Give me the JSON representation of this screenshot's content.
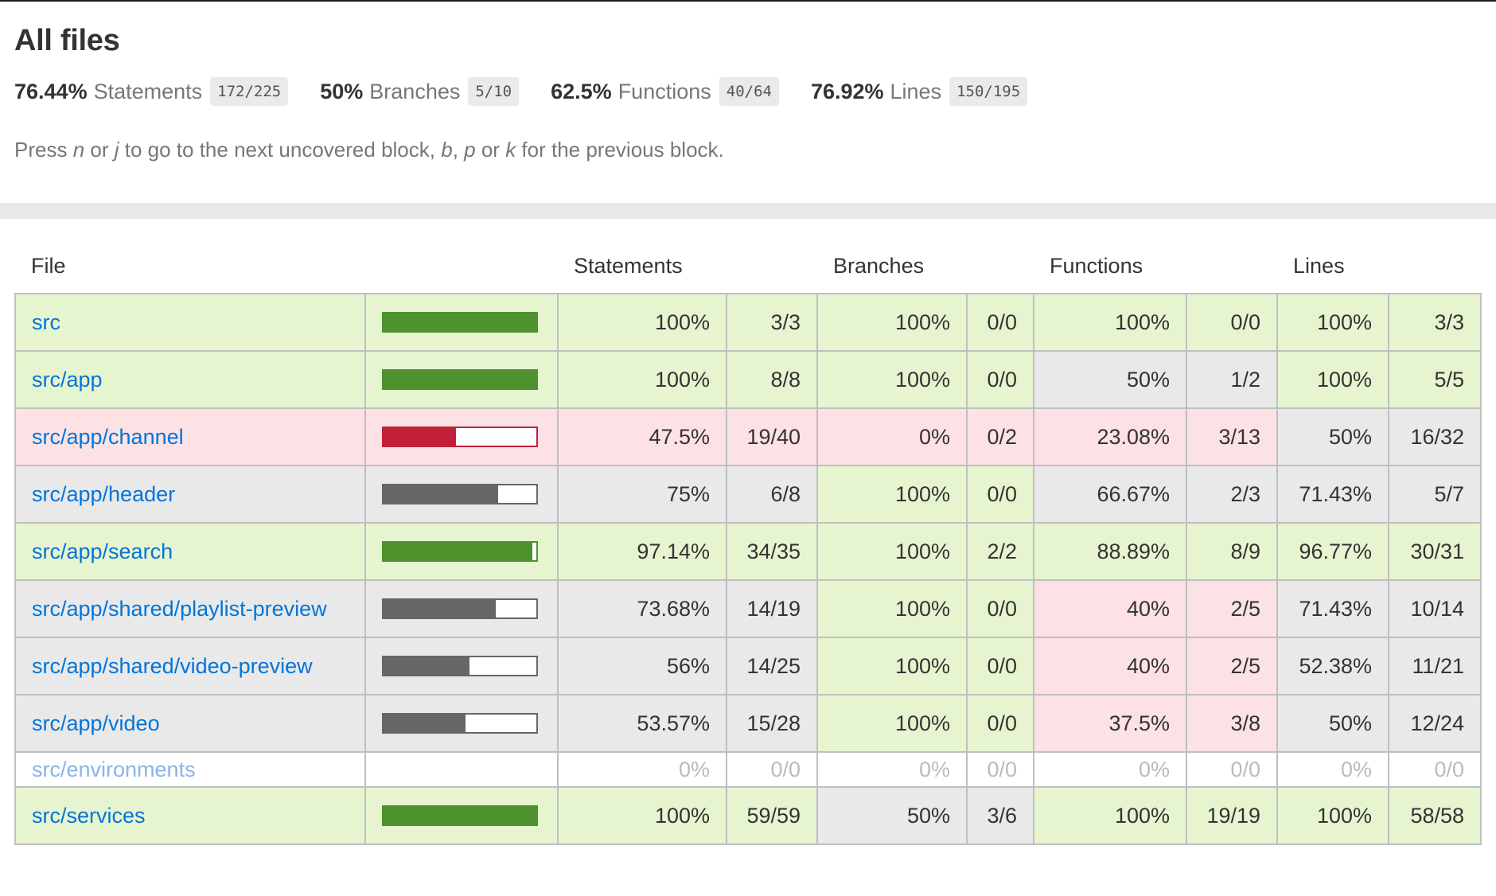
{
  "title": "All files",
  "summary": [
    {
      "pct": "76.44%",
      "label": "Statements",
      "frac": "172/225"
    },
    {
      "pct": "50%",
      "label": "Branches",
      "frac": "5/10"
    },
    {
      "pct": "62.5%",
      "label": "Functions",
      "frac": "40/64"
    },
    {
      "pct": "76.92%",
      "label": "Lines",
      "frac": "150/195"
    }
  ],
  "hint": {
    "t1": "Press ",
    "k1": "n",
    "t2": " or ",
    "k2": "j",
    "t3": " to go to the next uncovered block, ",
    "k3": "b",
    "t4": ", ",
    "k4": "p",
    "t5": " or ",
    "k5": "k",
    "t6": " for the previous block."
  },
  "table": {
    "headers": {
      "file": "File",
      "statements": "Statements",
      "branches": "Branches",
      "functions": "Functions",
      "lines": "Lines"
    },
    "rows": [
      {
        "file": "src",
        "bar_pct": 100,
        "stmt_pct": "100%",
        "stmt_frac": "3/3",
        "br_pct": "100%",
        "br_frac": "0/0",
        "fn_pct": "100%",
        "fn_frac": "0/0",
        "ln_pct": "100%",
        "ln_frac": "3/3",
        "c_stmt": "high",
        "c_br": "high",
        "c_fn": "high",
        "c_ln": "high",
        "c_file": "high"
      },
      {
        "file": "src/app",
        "bar_pct": 100,
        "stmt_pct": "100%",
        "stmt_frac": "8/8",
        "br_pct": "100%",
        "br_frac": "0/0",
        "fn_pct": "50%",
        "fn_frac": "1/2",
        "ln_pct": "100%",
        "ln_frac": "5/5",
        "c_stmt": "high",
        "c_br": "high",
        "c_fn": "medium",
        "c_ln": "high",
        "c_file": "high"
      },
      {
        "file": "src/app/channel",
        "bar_pct": 47.5,
        "stmt_pct": "47.5%",
        "stmt_frac": "19/40",
        "br_pct": "0%",
        "br_frac": "0/2",
        "fn_pct": "23.08%",
        "fn_frac": "3/13",
        "ln_pct": "50%",
        "ln_frac": "16/32",
        "c_stmt": "low",
        "c_br": "low",
        "c_fn": "low",
        "c_ln": "medium",
        "c_file": "low"
      },
      {
        "file": "src/app/header",
        "bar_pct": 75,
        "stmt_pct": "75%",
        "stmt_frac": "6/8",
        "br_pct": "100%",
        "br_frac": "0/0",
        "fn_pct": "66.67%",
        "fn_frac": "2/3",
        "ln_pct": "71.43%",
        "ln_frac": "5/7",
        "c_stmt": "medium",
        "c_br": "high",
        "c_fn": "medium",
        "c_ln": "medium",
        "c_file": "medium"
      },
      {
        "file": "src/app/search",
        "bar_pct": 97.14,
        "stmt_pct": "97.14%",
        "stmt_frac": "34/35",
        "br_pct": "100%",
        "br_frac": "2/2",
        "fn_pct": "88.89%",
        "fn_frac": "8/9",
        "ln_pct": "96.77%",
        "ln_frac": "30/31",
        "c_stmt": "high",
        "c_br": "high",
        "c_fn": "high",
        "c_ln": "high",
        "c_file": "high"
      },
      {
        "file": "src/app/shared/playlist-preview",
        "bar_pct": 73.68,
        "stmt_pct": "73.68%",
        "stmt_frac": "14/19",
        "br_pct": "100%",
        "br_frac": "0/0",
        "fn_pct": "40%",
        "fn_frac": "2/5",
        "ln_pct": "71.43%",
        "ln_frac": "10/14",
        "c_stmt": "medium",
        "c_br": "high",
        "c_fn": "low",
        "c_ln": "medium",
        "c_file": "medium"
      },
      {
        "file": "src/app/shared/video-preview",
        "bar_pct": 56,
        "stmt_pct": "56%",
        "stmt_frac": "14/25",
        "br_pct": "100%",
        "br_frac": "0/0",
        "fn_pct": "40%",
        "fn_frac": "2/5",
        "ln_pct": "52.38%",
        "ln_frac": "11/21",
        "c_stmt": "medium",
        "c_br": "high",
        "c_fn": "low",
        "c_ln": "medium",
        "c_file": "medium"
      },
      {
        "file": "src/app/video",
        "bar_pct": 53.57,
        "stmt_pct": "53.57%",
        "stmt_frac": "15/28",
        "br_pct": "100%",
        "br_frac": "0/0",
        "fn_pct": "37.5%",
        "fn_frac": "3/8",
        "ln_pct": "50%",
        "ln_frac": "12/24",
        "c_stmt": "medium",
        "c_br": "high",
        "c_fn": "low",
        "c_ln": "medium",
        "c_file": "medium"
      },
      {
        "file": "src/environments",
        "bar_pct": null,
        "stmt_pct": "0%",
        "stmt_frac": "0/0",
        "br_pct": "0%",
        "br_frac": "0/0",
        "fn_pct": "0%",
        "fn_frac": "0/0",
        "ln_pct": "0%",
        "ln_frac": "0/0",
        "c_stmt": "empty",
        "c_br": "empty",
        "c_fn": "empty",
        "c_ln": "empty",
        "c_file": "empty"
      },
      {
        "file": "src/services",
        "bar_pct": 100,
        "stmt_pct": "100%",
        "stmt_frac": "59/59",
        "br_pct": "50%",
        "br_frac": "3/6",
        "fn_pct": "100%",
        "fn_frac": "19/19",
        "ln_pct": "100%",
        "ln_frac": "58/58",
        "c_stmt": "high",
        "c_br": "medium",
        "c_fn": "high",
        "c_ln": "high",
        "c_file": "high"
      }
    ]
  },
  "colors": {
    "high": "#e6f5d0",
    "low": "#fce1e5",
    "medium": "#e9e9e9",
    "bar_high": "#4d922c",
    "bar_low": "#C21F39",
    "bar_medium": "#666666",
    "link": "#0074D9"
  }
}
